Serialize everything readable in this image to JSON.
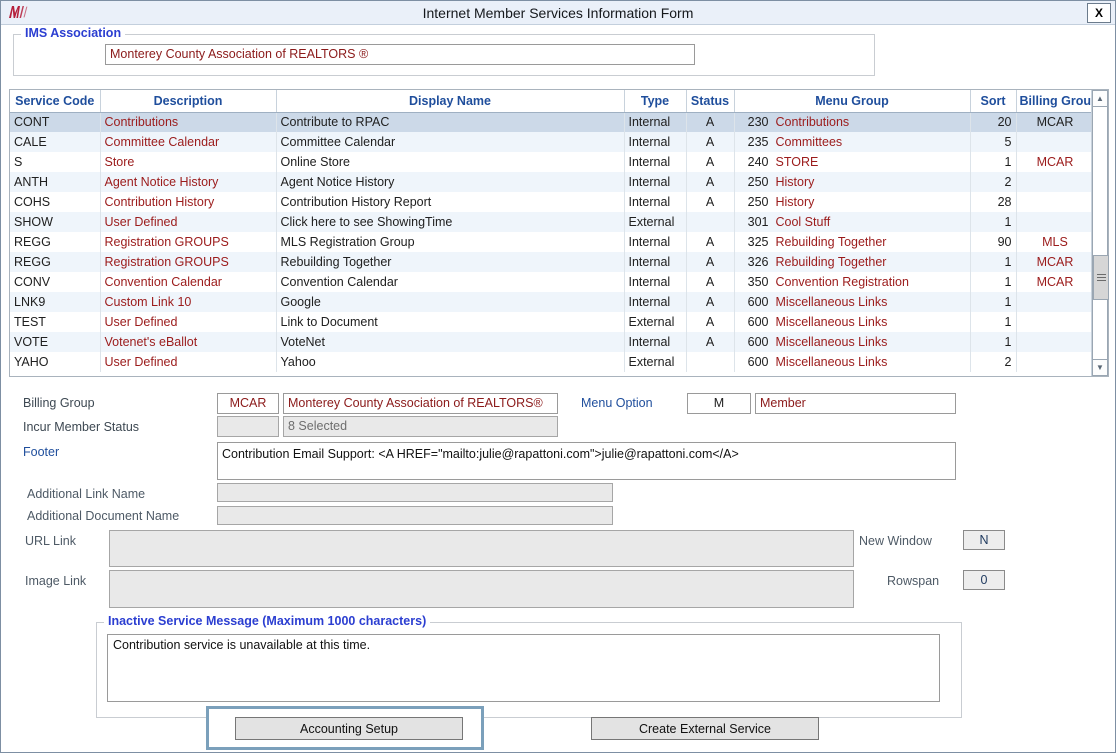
{
  "window": {
    "title": "Internet Member Services Information Form",
    "logo_icon": "rapattoni-m-logo",
    "close_label": "X",
    "close_icon": "close-icon"
  },
  "association_group": {
    "legend": "IMS Association",
    "value": "Monterey County Association of REALTORS ®"
  },
  "grid": {
    "columns": [
      "Service Code",
      "Description",
      "Display Name",
      "Type",
      "Status",
      "Menu Group",
      "Sort",
      "Billing Group"
    ],
    "rows": [
      {
        "service_code": "CONT",
        "description": "Contributions",
        "display_name": "Contribute to RPAC",
        "type": "Internal",
        "status": "A",
        "menu_group_num": "230",
        "menu_group": "Contributions",
        "sort": "20",
        "billing_group": "MCAR",
        "selected": true
      },
      {
        "service_code": "CALE",
        "description": "Committee Calendar",
        "display_name": "Committee Calendar",
        "type": "Internal",
        "status": "A",
        "menu_group_num": "235",
        "menu_group": "Committees",
        "sort": "5",
        "billing_group": "",
        "selected": false
      },
      {
        "service_code": "S",
        "description": "Store",
        "display_name": "Online Store",
        "type": "Internal",
        "status": "A",
        "menu_group_num": "240",
        "menu_group": "STORE",
        "sort": "1",
        "billing_group": "MCAR",
        "selected": false
      },
      {
        "service_code": "ANTH",
        "description": "Agent Notice History",
        "display_name": "Agent Notice History",
        "type": "Internal",
        "status": "A",
        "menu_group_num": "250",
        "menu_group": "History",
        "sort": "2",
        "billing_group": "",
        "selected": false
      },
      {
        "service_code": "COHS",
        "description": "Contribution History",
        "display_name": "Contribution History Report",
        "type": "Internal",
        "status": "A",
        "menu_group_num": "250",
        "menu_group": "History",
        "sort": "28",
        "billing_group": "",
        "selected": false
      },
      {
        "service_code": "SHOW",
        "description": "User Defined",
        "display_name": "Click here to see ShowingTime",
        "type": "External",
        "status": "",
        "menu_group_num": "301",
        "menu_group": "Cool Stuff",
        "sort": "1",
        "billing_group": "",
        "selected": false
      },
      {
        "service_code": "REGG",
        "description": "Registration GROUPS",
        "display_name": "MLS Registration Group",
        "type": "Internal",
        "status": "A",
        "menu_group_num": "325",
        "menu_group": "Rebuilding Together",
        "sort": "90",
        "billing_group": "MLS",
        "selected": false
      },
      {
        "service_code": "REGG",
        "description": "Registration GROUPS",
        "display_name": "Rebuilding Together",
        "type": "Internal",
        "status": "A",
        "menu_group_num": "326",
        "menu_group": "Rebuilding Together",
        "sort": "1",
        "billing_group": "MCAR",
        "selected": false
      },
      {
        "service_code": "CONV",
        "description": "Convention Calendar",
        "display_name": "Convention Calendar",
        "type": "Internal",
        "status": "A",
        "menu_group_num": "350",
        "menu_group": "Convention Registration",
        "sort": "1",
        "billing_group": "MCAR",
        "selected": false
      },
      {
        "service_code": "LNK9",
        "description": "Custom Link 10",
        "display_name": "Google",
        "type": "Internal",
        "status": "A",
        "menu_group_num": "600",
        "menu_group": "Miscellaneous Links",
        "sort": "1",
        "billing_group": "",
        "selected": false
      },
      {
        "service_code": "TEST",
        "description": "User Defined",
        "display_name": "Link to Document",
        "type": "External",
        "status": "A",
        "menu_group_num": "600",
        "menu_group": "Miscellaneous Links",
        "sort": "1",
        "billing_group": "",
        "selected": false
      },
      {
        "service_code": "VOTE",
        "description": "Votenet's eBallot",
        "display_name": "VoteNet",
        "type": "Internal",
        "status": "A",
        "menu_group_num": "600",
        "menu_group": "Miscellaneous Links",
        "sort": "1",
        "billing_group": "",
        "selected": false
      },
      {
        "service_code": "YAHO",
        "description": "User Defined",
        "display_name": "Yahoo",
        "type": "External",
        "status": "",
        "menu_group_num": "600",
        "menu_group": "Miscellaneous Links",
        "sort": "2",
        "billing_group": "",
        "selected": false
      }
    ],
    "scrollbar": {
      "up_icon": "chevron-up-icon",
      "down_icon": "chevron-down-icon",
      "thumb_icon": "scroll-thumb-grip"
    }
  },
  "detail": {
    "billing_group_label": "Billing Group",
    "billing_group_code": "MCAR",
    "billing_group_name": "Monterey County Association of REALTORS®",
    "menu_option_label": "Menu Option",
    "menu_option_code": "M",
    "menu_option_name": "Member",
    "incur_member_status_label": "Incur Member Status",
    "incur_member_status_code": "",
    "incur_member_status_value": "8 Selected",
    "footer_label": "Footer",
    "footer_value": "Contribution Email Support: <A HREF=\"mailto:julie@rapattoni.com\">julie@rapattoni.com</A>",
    "additional_link_name_label": "Additional Link Name",
    "additional_link_name_value": "",
    "additional_document_name_label": "Additional Document Name",
    "additional_document_name_value": "",
    "url_link_label": "URL Link",
    "url_link_value": "",
    "image_link_label": "Image Link",
    "image_link_value": "",
    "new_window_label": "New Window",
    "new_window_value": "N",
    "rowspan_label": "Rowspan",
    "rowspan_value": "0"
  },
  "inactive_message": {
    "legend": "Inactive Service Message (Maximum 1000 characters)",
    "value": "Contribution service is unavailable at this time."
  },
  "buttons": {
    "accounting_setup": "Accounting Setup",
    "create_external_service": "Create External Service"
  },
  "colors": {
    "legend_blue": "#2b3ed1",
    "header_blue": "#1f4e9c",
    "value_red": "#8b1a1a",
    "row_selected": "#ccd9e8",
    "row_alt": "#eff5fb",
    "titlebar": "#eaf0f9",
    "focus_ring": "#7ba0bb"
  }
}
